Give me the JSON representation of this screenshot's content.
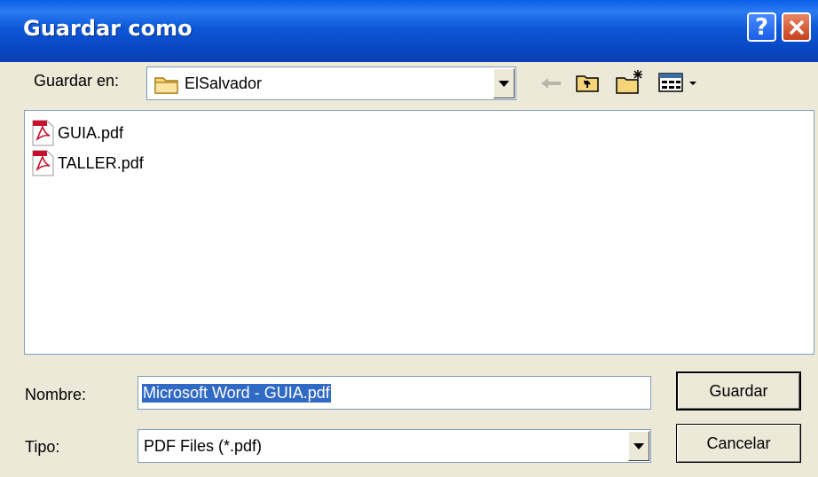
{
  "title": "Guardar como",
  "save_in": {
    "label": "Guardar en:",
    "value": "ElSalvador"
  },
  "toolbar": {
    "back": "back-arrow",
    "up": "up-folder",
    "new_folder": "new-folder",
    "views": "view-menu"
  },
  "files": [
    {
      "name": "GUIA.pdf",
      "icon": "pdf-icon"
    },
    {
      "name": "TALLER.pdf",
      "icon": "pdf-icon"
    }
  ],
  "filename": {
    "label": "Nombre:",
    "value": "Microsoft Word - GUIA.pdf"
  },
  "filetype": {
    "label": "Tipo:",
    "value": "PDF Files (*.pdf)"
  },
  "buttons": {
    "save": "Guardar",
    "cancel": "Cancelar"
  },
  "colors": {
    "titlebar": "#0A4FD8",
    "face": "#ECE9D8",
    "selection": "#316AC5"
  }
}
